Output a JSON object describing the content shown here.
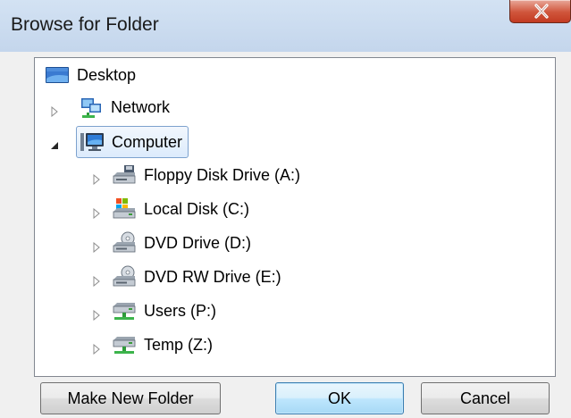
{
  "window": {
    "title": "Browse for Folder"
  },
  "tree": {
    "nodes": [
      {
        "label": "Desktop",
        "icon": "desktop-icon",
        "level": 0
      },
      {
        "label": "Network",
        "icon": "network-icon",
        "level": 1,
        "expander": "collapsed"
      },
      {
        "label": "Computer",
        "icon": "computer-icon",
        "level": 1,
        "expander": "expanded",
        "selected": true
      },
      {
        "label": "Floppy Disk Drive (A:)",
        "icon": "floppy-drive-icon",
        "level": 2,
        "expander": "collapsed"
      },
      {
        "label": "Local Disk (C:)",
        "icon": "local-disk-icon",
        "level": 2,
        "expander": "collapsed"
      },
      {
        "label": "DVD Drive (D:)",
        "icon": "dvd-drive-icon",
        "level": 2,
        "expander": "collapsed"
      },
      {
        "label": "DVD RW Drive (E:)",
        "icon": "dvd-rw-drive-icon",
        "level": 2,
        "expander": "collapsed"
      },
      {
        "label": "Users (P:)",
        "icon": "network-drive-icon",
        "level": 2,
        "expander": "collapsed"
      },
      {
        "label": "Temp (Z:)",
        "icon": "network-drive-icon",
        "level": 2,
        "expander": "collapsed"
      }
    ]
  },
  "buttons": {
    "make_new_folder": "Make New Folder",
    "ok": "OK",
    "cancel": "Cancel"
  },
  "colors": {
    "titlebar": "#c4d6ec",
    "close_button": "#c9452c",
    "selection_border": "#7da2ce",
    "dialog_body": "#f0f0f0"
  }
}
